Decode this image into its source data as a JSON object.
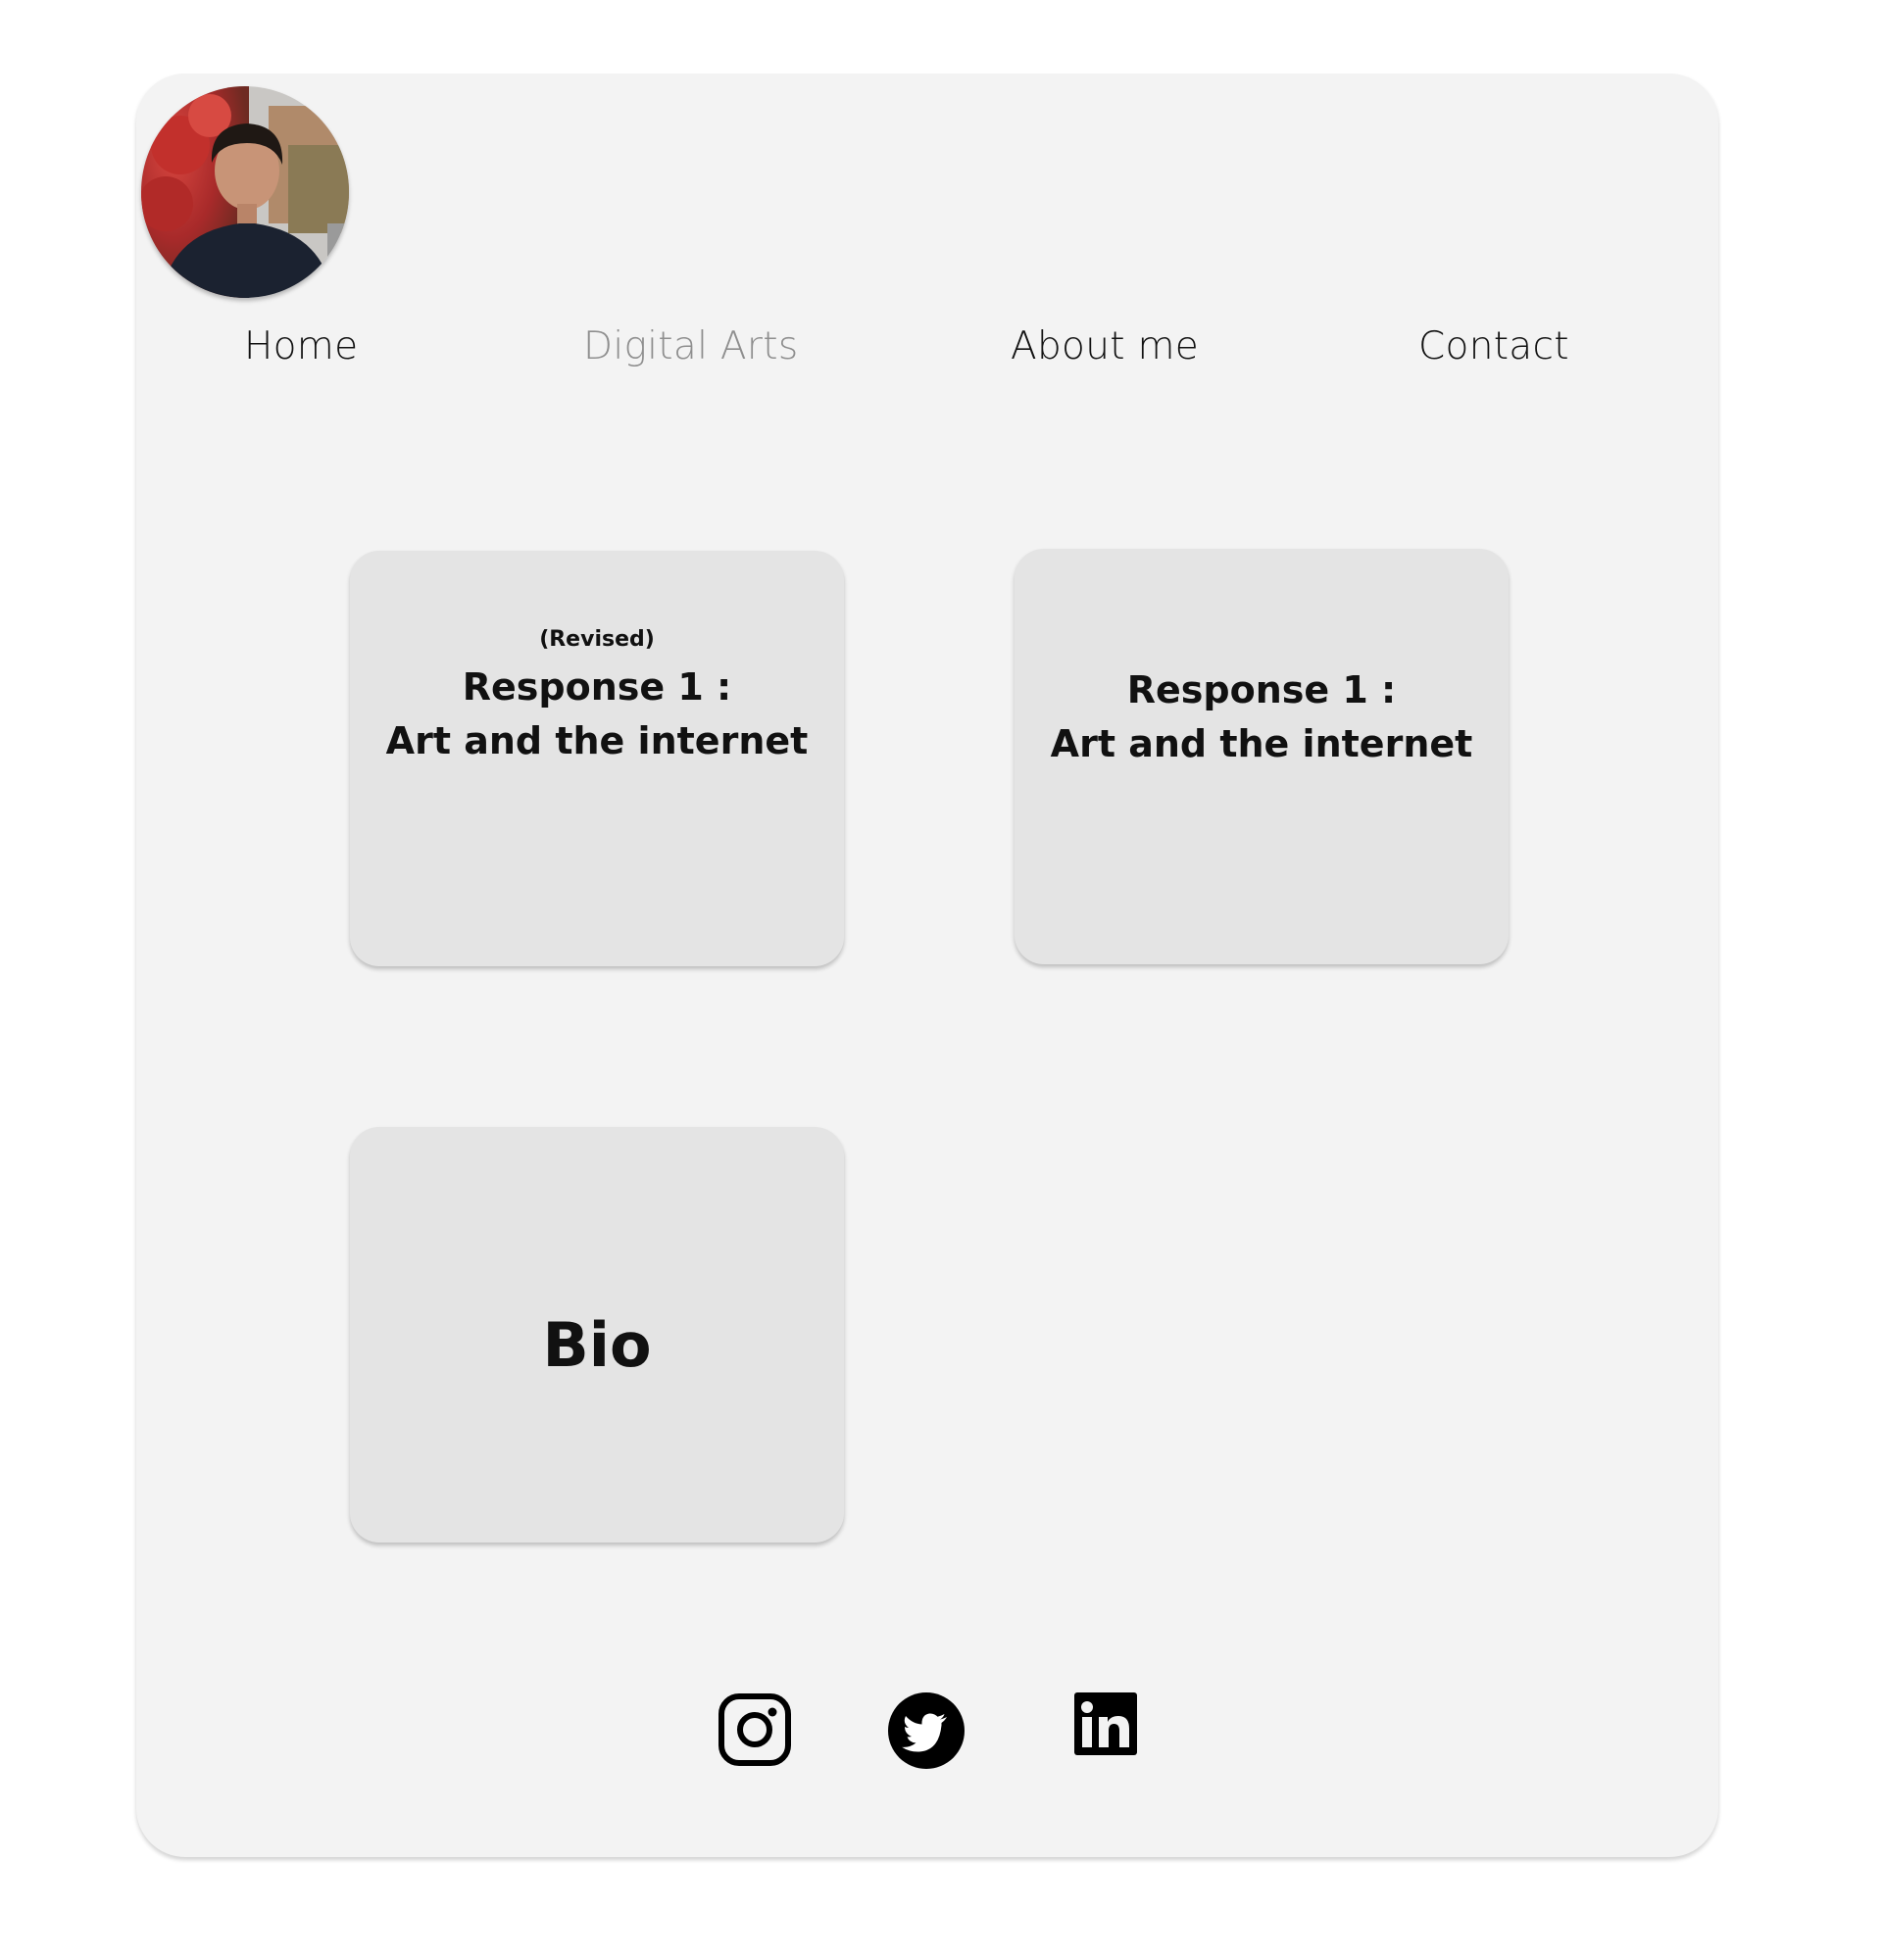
{
  "nav": {
    "items": [
      {
        "label": "Home"
      },
      {
        "label": "Digital Arts"
      },
      {
        "label": "About me"
      },
      {
        "label": "Contact"
      }
    ],
    "active": "Digital Arts"
  },
  "profile": {
    "avatar_icon": "profile-photo"
  },
  "cards": [
    {
      "subtitle": "(Revised)",
      "line1": "Response 1 :",
      "line2": "Art and the internet"
    },
    {
      "line1": "Response 1 :",
      "line2": "Art and the internet"
    },
    {
      "title": "Bio"
    }
  ],
  "social": [
    {
      "icon": "instagram-icon"
    },
    {
      "icon": "twitter-icon"
    },
    {
      "icon": "linkedin-icon"
    }
  ],
  "colors": {
    "page_bg": "#ffffff",
    "frame_bg": "#f3f3f3",
    "card_bg": "#e4e4e4",
    "text": "#111111",
    "nav_active": "#8e8e8e"
  }
}
